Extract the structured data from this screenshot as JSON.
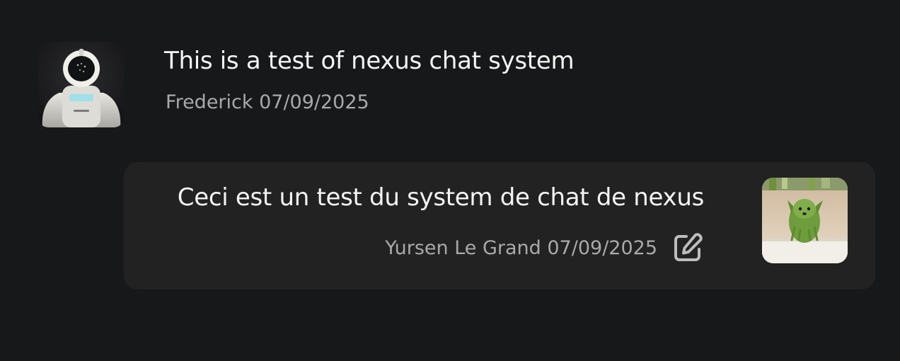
{
  "messages": [
    {
      "text": "This is a test of nexus chat system",
      "author": "Frederick",
      "date": "07/09/2025",
      "avatar_icon": "robot-avatar",
      "meta": "Frederick 07/09/2025"
    },
    {
      "text": "Ceci est un test du system de chat de nexus",
      "author": "Yursen Le Grand",
      "date": "07/09/2025",
      "avatar_icon": "dog-avatar",
      "edit_icon": "edit-icon",
      "meta": "Yursen Le Grand 07/09/2025"
    }
  ],
  "colors": {
    "background": "#17181a",
    "bubble": "#222223",
    "text": "#f4f4f4",
    "meta": "#a9a9ab"
  }
}
